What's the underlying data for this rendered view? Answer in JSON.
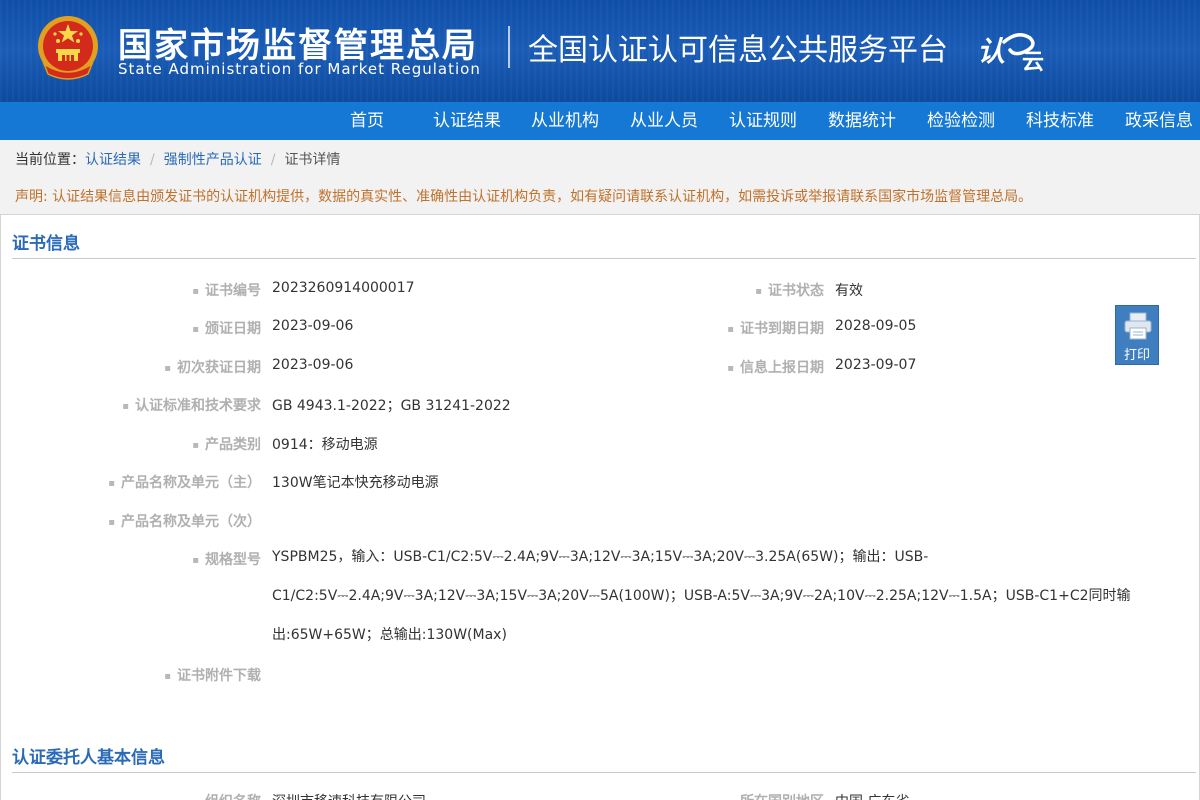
{
  "header": {
    "agency_cn": "国家市场监督管理总局",
    "agency_en": "State Administration  for  Market Regulation",
    "platform": "全国认证认可信息公共服务平台",
    "logo_a": "认",
    "logo_b": "云"
  },
  "nav": [
    "首页",
    "认证结果",
    "从业机构",
    "从业人员",
    "认证规则",
    "数据统计",
    "检验检测",
    "科技标准",
    "政采信息"
  ],
  "breadcrumb": {
    "prefix": "当前位置：",
    "items": [
      "认证结果",
      "强制性产品认证",
      "证书详情"
    ],
    "separator": "/"
  },
  "notice": "声明: 认证结果信息由颁发证书的认证机构提供，数据的真实性、准确性由认证机构负责，如有疑问请联系认证机构，如需投诉或举报请联系国家市场监督管理总局。",
  "cert_section": {
    "title": "证书信息",
    "fields": {
      "cert_no": {
        "label": "证书编号",
        "value": "2023260914000017"
      },
      "cert_status": {
        "label": "证书状态",
        "value": "有效"
      },
      "issue_date": {
        "label": "颁证日期",
        "value": "2023-09-06"
      },
      "expiry_date": {
        "label": "证书到期日期",
        "value": "2028-09-05"
      },
      "first_date": {
        "label": "初次获证日期",
        "value": "2023-09-06"
      },
      "report_date": {
        "label": "信息上报日期",
        "value": "2023-09-07"
      },
      "standards": {
        "label": "认证标准和技术要求",
        "value": "GB 4943.1-2022；GB 31241-2022"
      },
      "category": {
        "label": "产品类别",
        "value": "0914：移动电源"
      },
      "name_main": {
        "label": "产品名称及单元（主）",
        "value": "130W笔记本快充移动电源"
      },
      "name_sub": {
        "label": "产品名称及单元（次）",
        "value": ""
      },
      "model": {
        "label": "规格型号",
        "value": "YSPBM25，输入：USB-C1/C2:5V⎓2.4A;9V⎓3A;12V⎓3A;15V⎓3A;20V⎓3.25A(65W)；输出：USB-C1/C2:5V⎓2.4A;9V⎓3A;12V⎓3A;15V⎓3A;20V⎓5A(100W)；USB-A:5V⎓3A;9V⎓2A;10V⎓2.25A;12V⎓1.5A；USB-C1+C2同时输出:65W+65W；总输出:130W(Max)"
      },
      "attachment": {
        "label": "证书附件下载",
        "value": ""
      }
    },
    "print_label": "打印"
  },
  "client_section": {
    "title": "认证委托人基本信息",
    "fields": {
      "org_name": {
        "label": "组织名称",
        "value": "深圳市移速科技有限公司"
      },
      "region": {
        "label": "所在国别地区",
        "value": "中国 广东省"
      }
    }
  }
}
